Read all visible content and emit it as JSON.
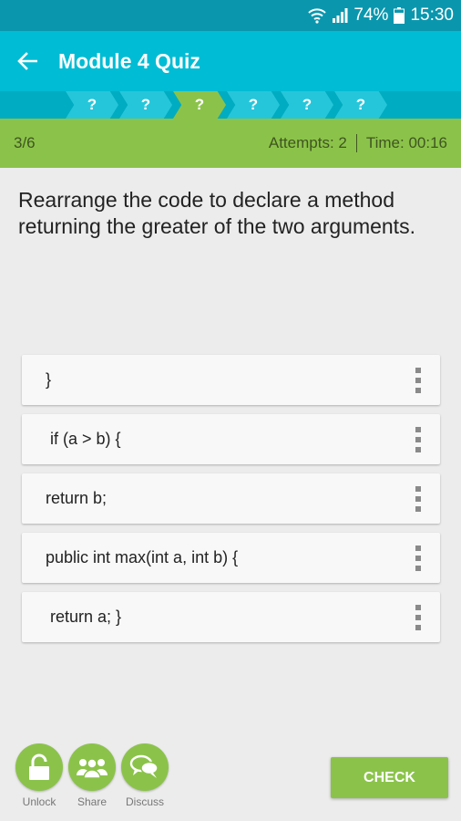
{
  "status_bar": {
    "battery": "74%",
    "time": "15:30"
  },
  "app_bar": {
    "title": "Module 4 Quiz"
  },
  "progress": {
    "steps": [
      {
        "label": "?",
        "current": false
      },
      {
        "label": "?",
        "current": false
      },
      {
        "label": "?",
        "current": true
      },
      {
        "label": "?",
        "current": false
      },
      {
        "label": "?",
        "current": false
      },
      {
        "label": "?",
        "current": false
      }
    ]
  },
  "info_bar": {
    "position": "3/6",
    "attempts": "Attempts: 2",
    "time": "Time: 00:16"
  },
  "question": "Rearrange the code to declare a method returning the greater of the two arguments.",
  "code_lines": [
    "}",
    " if (a > b) {",
    "return b;",
    "public int max(int a, int b) {",
    " return a; }"
  ],
  "actions": [
    {
      "label": "Unlock",
      "icon": "lock-icon"
    },
    {
      "label": "Share",
      "icon": "people-icon"
    },
    {
      "label": "Discuss",
      "icon": "chat-bubbles-icon"
    }
  ],
  "check_label": "CHECK",
  "colors": {
    "status_bar": "#0a97ae",
    "app_bar": "#00bcd4",
    "progress_strip": "#00acc1",
    "chevron": "#26c6da",
    "accent_green": "#8bc34a"
  }
}
